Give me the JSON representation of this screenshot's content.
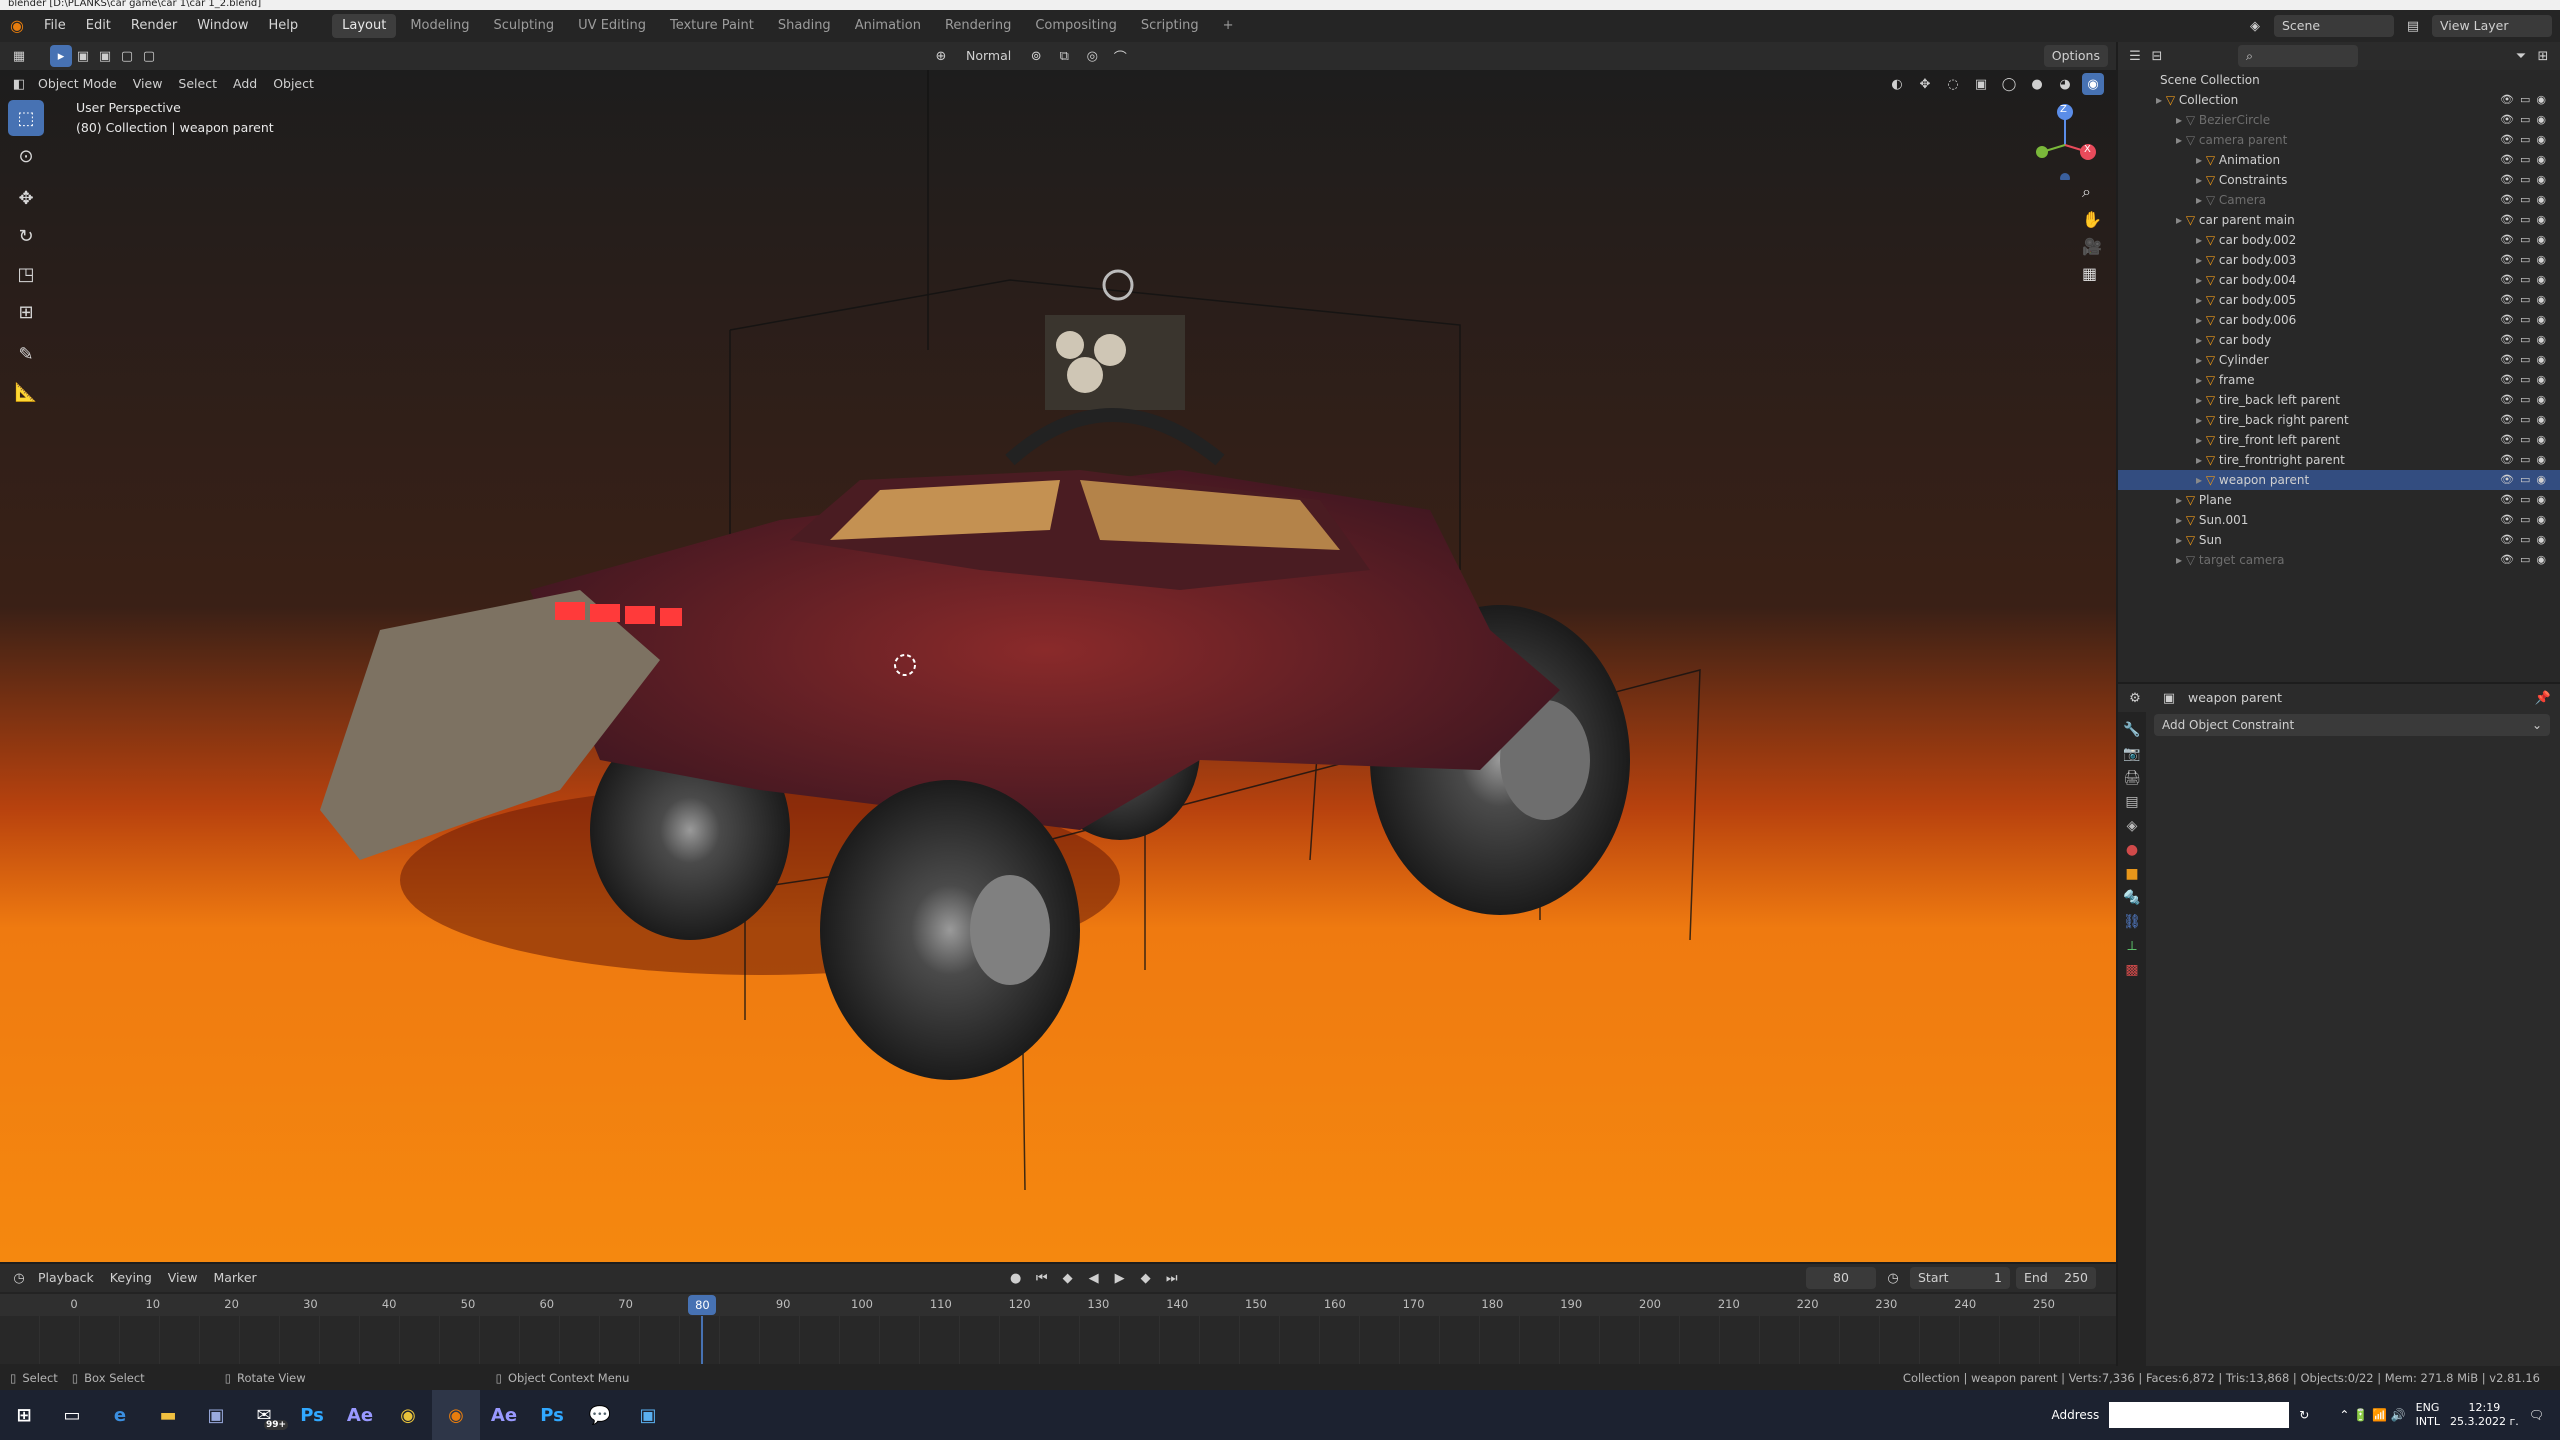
{
  "window": {
    "title": "blender [D:\\PLANKS\\car game\\car 1\\car 1_2.blend]"
  },
  "menu": {
    "items": [
      "File",
      "Edit",
      "Render",
      "Window",
      "Help"
    ]
  },
  "workspaces": {
    "tabs": [
      "Layout",
      "Modeling",
      "Sculpting",
      "UV Editing",
      "Texture Paint",
      "Shading",
      "Animation",
      "Rendering",
      "Compositing",
      "Scripting"
    ],
    "active": "Layout",
    "add": "+"
  },
  "scene": {
    "label": "Scene",
    "view_layer": "View Layer"
  },
  "viewport_header": {
    "mode": "Object Mode",
    "menus": [
      "View",
      "Select",
      "Add",
      "Object"
    ],
    "orientation": "Normal",
    "options": "Options"
  },
  "viewport": {
    "perspective": "User Perspective",
    "collection_info": "(80) Collection | weapon parent",
    "gizmo": {
      "x": "X",
      "y": "Y",
      "z": "Z"
    }
  },
  "outliner": {
    "root": "Scene Collection",
    "rows": [
      {
        "label": "Collection",
        "indent": 1,
        "dim": false
      },
      {
        "label": "BezierCircle",
        "indent": 2,
        "dim": true
      },
      {
        "label": "camera parent",
        "indent": 2,
        "dim": true
      },
      {
        "label": "Animation",
        "indent": 3,
        "dim": false
      },
      {
        "label": "Constraints",
        "indent": 3,
        "dim": false
      },
      {
        "label": "Camera",
        "indent": 3,
        "dim": true
      },
      {
        "label": "car parent main",
        "indent": 2,
        "dim": false
      },
      {
        "label": "car body.002",
        "indent": 3,
        "dim": false
      },
      {
        "label": "car body.003",
        "indent": 3,
        "dim": false
      },
      {
        "label": "car body.004",
        "indent": 3,
        "dim": false
      },
      {
        "label": "car body.005",
        "indent": 3,
        "dim": false
      },
      {
        "label": "car body.006",
        "indent": 3,
        "dim": false
      },
      {
        "label": "car body",
        "indent": 3,
        "dim": false
      },
      {
        "label": "Cylinder",
        "indent": 3,
        "dim": false
      },
      {
        "label": "frame",
        "indent": 3,
        "dim": false
      },
      {
        "label": "tire_back left parent",
        "indent": 3,
        "dim": false
      },
      {
        "label": "tire_back right parent",
        "indent": 3,
        "dim": false
      },
      {
        "label": "tire_front left parent",
        "indent": 3,
        "dim": false
      },
      {
        "label": "tire_frontright parent",
        "indent": 3,
        "dim": false
      },
      {
        "label": "weapon parent",
        "indent": 3,
        "dim": false
      },
      {
        "label": "Plane",
        "indent": 2,
        "dim": false
      },
      {
        "label": "Sun.001",
        "indent": 2,
        "dim": false
      },
      {
        "label": "Sun",
        "indent": 2,
        "dim": false
      },
      {
        "label": "target camera",
        "indent": 2,
        "dim": true
      }
    ]
  },
  "properties": {
    "object_name": "weapon parent",
    "add_constraint": "Add Object Constraint"
  },
  "timeline": {
    "menus": [
      "Playback",
      "Keying",
      "View",
      "Marker"
    ],
    "current_frame": "80",
    "start_label": "Start",
    "start": "1",
    "end_label": "End",
    "end": "250",
    "ticks": [
      "0",
      "10",
      "20",
      "30",
      "40",
      "50",
      "60",
      "70",
      "80",
      "90",
      "100",
      "110",
      "120",
      "130",
      "140",
      "150",
      "160",
      "170",
      "180",
      "190",
      "200",
      "210",
      "220",
      "230",
      "240",
      "250"
    ]
  },
  "status": {
    "select": "Select",
    "box_select": "Box Select",
    "rotate": "Rotate View",
    "context": "Object Context Menu",
    "stats": "Collection | weapon parent | Verts:7,336 | Faces:6,872 | Tris:13,868 | Objects:0/22 | Mem: 271.8 MiB | v2.81.16"
  },
  "taskbar": {
    "address_label": "Address",
    "lang": "ENG",
    "lang2": "INTL",
    "time": "12:19",
    "date": "25.3.2022 г.",
    "badge": "99+"
  },
  "colors": {
    "accent": "#4772b3",
    "ground": "#f5880f",
    "selected_row": "#334d80"
  }
}
